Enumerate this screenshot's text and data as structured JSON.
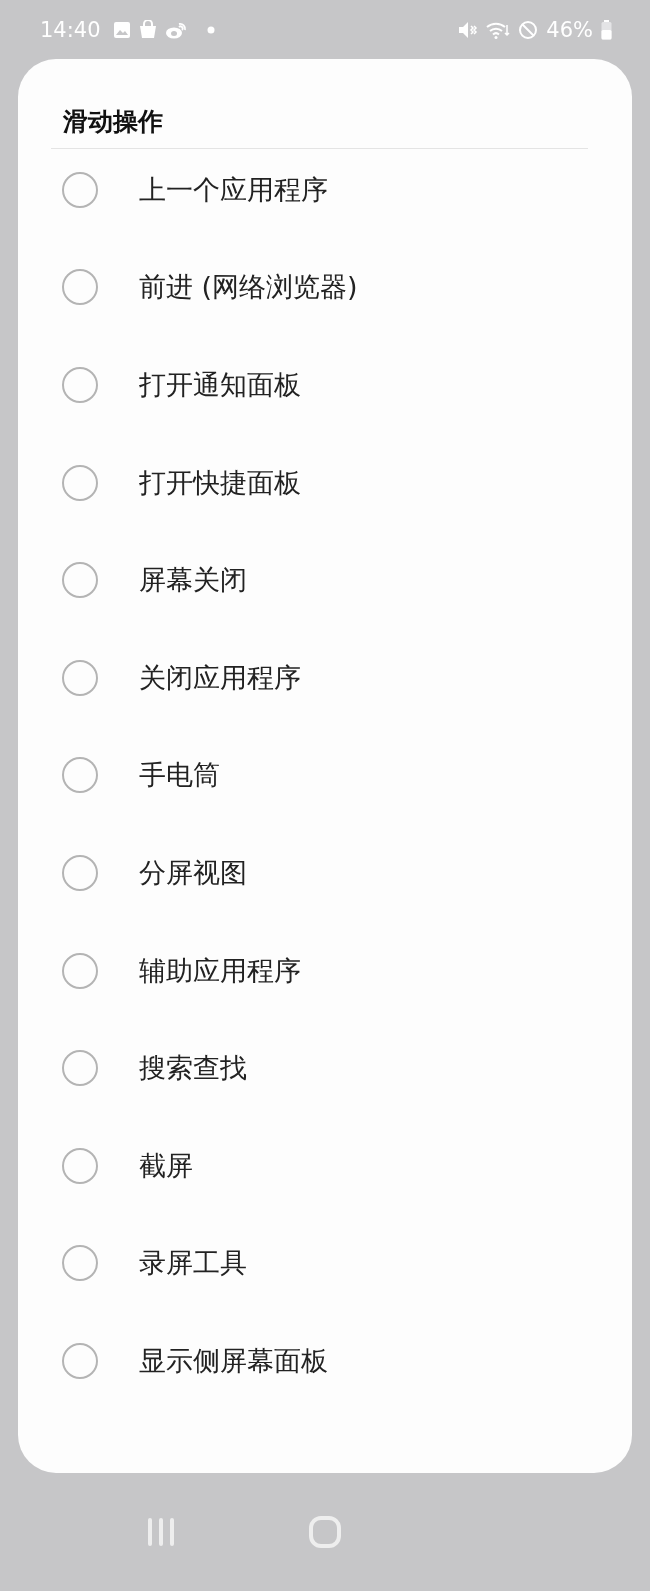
{
  "status_bar": {
    "time": "14:40",
    "battery": "46%"
  },
  "dialog": {
    "title": "滑动操作",
    "options": [
      {
        "label": "上一个应用程序",
        "selected": false
      },
      {
        "label": "前进 (网络浏览器)",
        "selected": false
      },
      {
        "label": "打开通知面板",
        "selected": false
      },
      {
        "label": "打开快捷面板",
        "selected": false
      },
      {
        "label": "屏幕关闭",
        "selected": false
      },
      {
        "label": "关闭应用程序",
        "selected": false
      },
      {
        "label": "手电筒",
        "selected": false
      },
      {
        "label": "分屏视图",
        "selected": false
      },
      {
        "label": "辅助应用程序",
        "selected": false
      },
      {
        "label": "搜索查找",
        "selected": false
      },
      {
        "label": "截屏",
        "selected": false
      },
      {
        "label": "录屏工具",
        "selected": false
      },
      {
        "label": "显示侧屏幕面板",
        "selected": false
      }
    ]
  }
}
